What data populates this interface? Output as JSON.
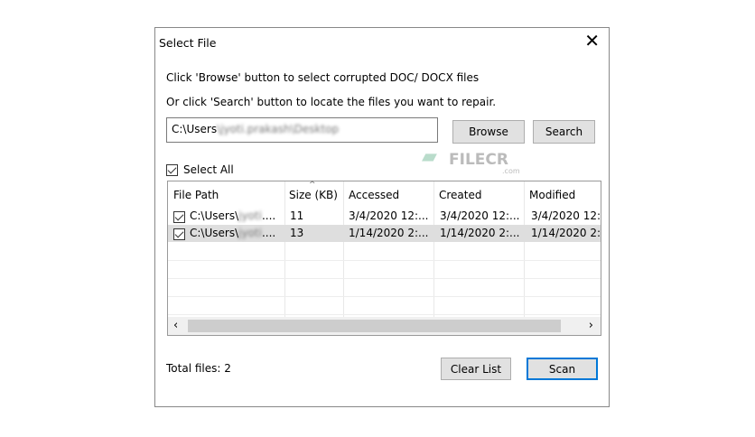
{
  "dialog": {
    "title": "Select File",
    "close_icon": "close-icon"
  },
  "instructions": [
    "Click 'Browse' button to select corrupted DOC/ DOCX files",
    "Or click 'Search' button to locate the files you want to repair."
  ],
  "path_input": {
    "prefix": "C:\\Users",
    "blurred": "\\jyoti.prakash\\Desktop"
  },
  "buttons": {
    "browse": "Browse",
    "search": "Search",
    "clear": "Clear List",
    "scan": "Scan"
  },
  "select_all": {
    "label": "Select All",
    "checked": true
  },
  "watermark": {
    "text": "FILECR",
    "sub": ".com"
  },
  "table": {
    "columns": [
      "File Path",
      "Size (KB)",
      "Accessed",
      "Created",
      "Modified"
    ],
    "rows": [
      {
        "checked": true,
        "path": "C:\\Users\\",
        "path_blur": "jyoti",
        "path_end": "....",
        "size": "11",
        "accessed": "3/4/2020 12:...",
        "created": "3/4/2020 12:...",
        "modified": "3/4/2020 12:"
      },
      {
        "checked": true,
        "path": "C:\\Users\\",
        "path_blur": "jyoti",
        "path_end": "....",
        "size": "13",
        "accessed": "1/14/2020 2:...",
        "created": "1/14/2020 2:...",
        "modified": "1/14/2020 2:"
      }
    ]
  },
  "footer": {
    "total_label": "Total files:",
    "total_value": "2"
  }
}
